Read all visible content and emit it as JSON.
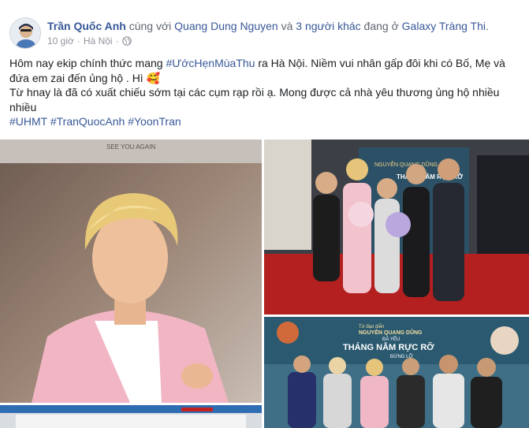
{
  "post": {
    "author": "Trần Quốc Anh",
    "with_text": " cùng với ",
    "tagged_person": "Quang Dung Nguyen",
    "and_text": " và ",
    "others": "3 người khác",
    "at_text": " đang ở ",
    "location": "Galaxy Tràng Thi",
    "period": ".",
    "time": "10 giờ",
    "separator": "·",
    "place": "Hà Nội",
    "line1_a": "Hôm nay ekip chính thức mang ",
    "line1_tag": "#ƯớcHẹnMùaThu",
    "line1_b": " ra Hà Nội. Niềm vui nhân gấp đôi khi có Bố, Mẹ và",
    "line2": "đứa em zai đến ủng hộ . Hì 🥰",
    "line3": "Từ hnay là đã có xuất chiếu sớm tại các cụm rạp rồi ạ. Mong được cả nhà yêu thương ủng hộ nhiều",
    "line4": "nhiều",
    "hashtags": [
      "#UHMT",
      "#TranQuocAnh",
      "#YoonTran"
    ]
  },
  "photos": {
    "p1_sign": "SEE YOU AGAIN",
    "p2_poster_small": "NGUYỄN QUANG DŨNG",
    "p2_poster_title": "THÁNG NĂM RỰC RỠ",
    "p3_poster_small": "Từ đạo diễn",
    "p3_poster_director": "NGUYỄN QUANG DŨNG",
    "p3_poster_sub": "ĐÃ YÊU",
    "p3_poster_title": "THÁNG NĂM RỰC RỠ",
    "p3_poster_sub2": "ĐỪNG LỠ"
  },
  "icons": {
    "globe": "globe-icon"
  },
  "colors": {
    "link": "#385898",
    "meta": "#90949c",
    "text": "#1c1e21"
  }
}
